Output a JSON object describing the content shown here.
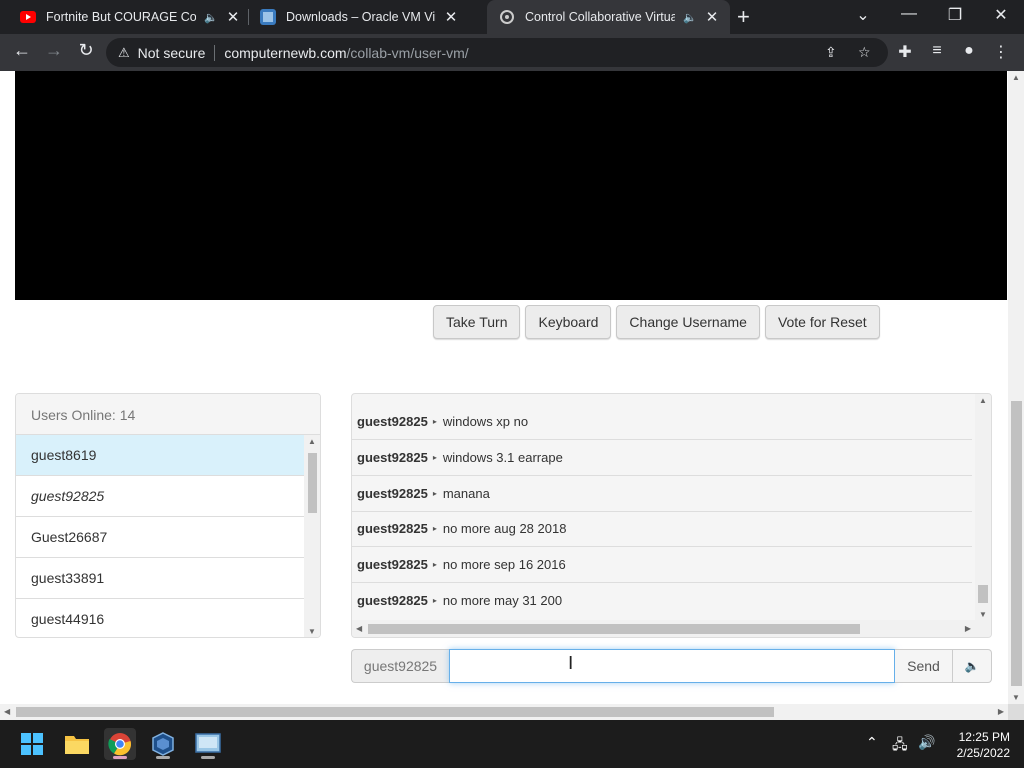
{
  "browser": {
    "tabs": [
      {
        "title": "Fortnite But COURAGE Controls",
        "favicon": "youtube-icon",
        "audio": true
      },
      {
        "title": "Downloads – Oracle VM VirtualBox",
        "favicon": "virtualbox-icon",
        "audio": false
      },
      {
        "title": "Control Collaborative Virtual Machines",
        "favicon": "collabvm-icon",
        "audio": true,
        "active": true
      }
    ],
    "security_label": "Not secure",
    "url_host": "computernewb.com",
    "url_path": "/collab-vm/user-vm/"
  },
  "vm_controls": {
    "take_turn": "Take Turn",
    "keyboard": "Keyboard",
    "change_username": "Change Username",
    "vote_reset": "Vote for Reset"
  },
  "users_panel": {
    "header": "Users Online: 14",
    "users": [
      {
        "name": "guest8619",
        "state": "active"
      },
      {
        "name": "guest92825",
        "state": "self"
      },
      {
        "name": "Guest26687",
        "state": ""
      },
      {
        "name": "guest33891",
        "state": ""
      },
      {
        "name": "guest44916",
        "state": ""
      }
    ]
  },
  "chat": {
    "messages": [
      {
        "user": "guest92825",
        "text": "windows xp no"
      },
      {
        "user": "guest92825",
        "text": "windows 3.1 earrape"
      },
      {
        "user": "guest92825",
        "text": "manana"
      },
      {
        "user": "guest92825",
        "text": "no more aug 28 2018"
      },
      {
        "user": "guest92825",
        "text": "no more sep 16 2016"
      },
      {
        "user": "guest92825",
        "text": "no more may 31 200"
      }
    ],
    "username_label": "guest92825",
    "input_value": "",
    "send_label": "Send"
  },
  "taskbar": {
    "apps": [
      "windows-start-icon",
      "file-explorer-icon",
      "chrome-icon",
      "virtualbox-icon",
      "vm-window-icon"
    ],
    "time": "12:25 PM",
    "date": "2/25/2022"
  },
  "colors": {
    "accent_active_user": "#d9f1fb",
    "vm_screen": "#000000",
    "chrome_dark": "#202124"
  }
}
